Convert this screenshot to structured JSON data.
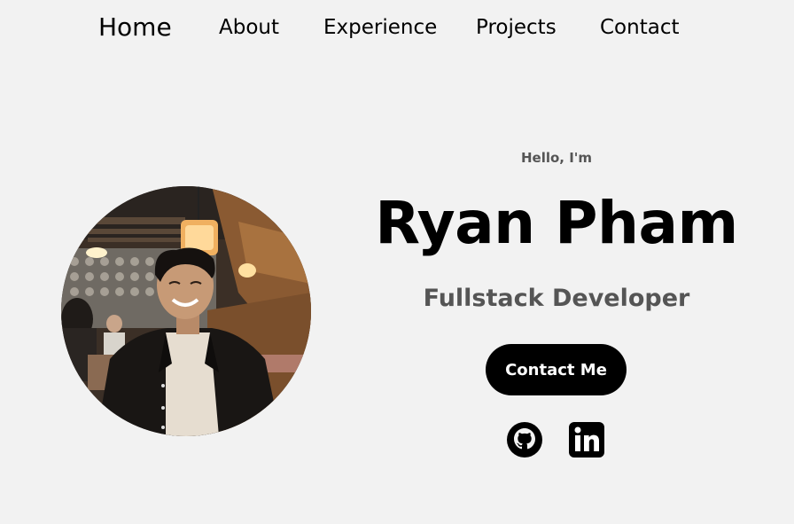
{
  "nav": {
    "home": "Home",
    "about": "About",
    "experience": "Experience",
    "projects": "Projects",
    "contact": "Contact"
  },
  "hero": {
    "greeting": "Hello, I'm",
    "name": "Ryan Pham",
    "role": "Fullstack Developer",
    "contact_button": "Contact Me"
  },
  "social": {
    "github_icon": "github-icon",
    "linkedin_icon": "linkedin-icon"
  },
  "colors": {
    "background": "#f2f2f2",
    "text": "#000000",
    "muted_text": "#555555",
    "button_bg": "#000000",
    "button_text": "#ffffff"
  }
}
